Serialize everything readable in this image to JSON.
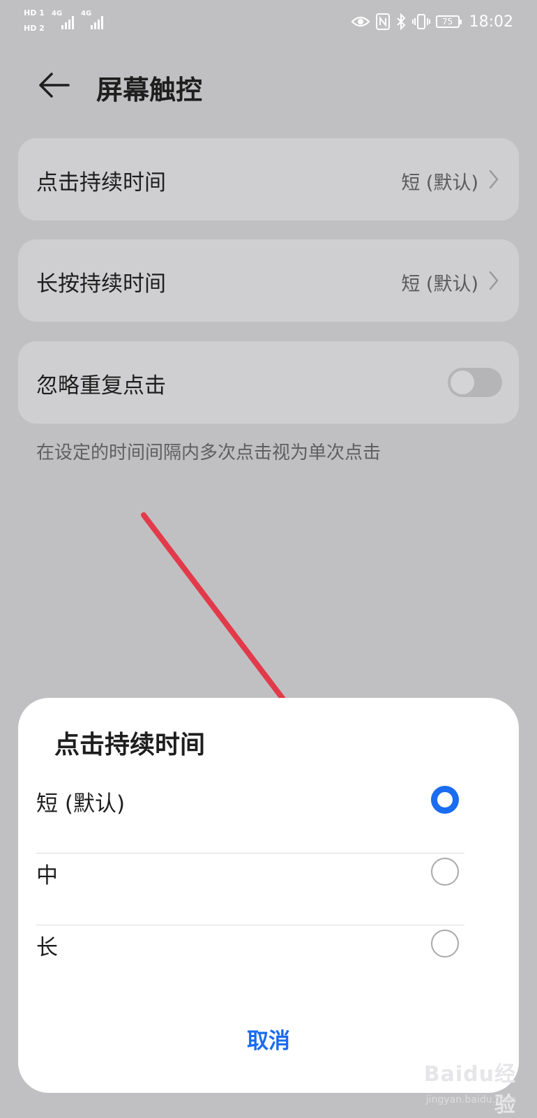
{
  "status_bar": {
    "sim1_label": "HD 1",
    "sim2_label": "HD 2",
    "network1": "4G",
    "network2": "4G",
    "battery_level": "75",
    "time": "18:02",
    "icons": [
      "eye-icon",
      "nfc-icon",
      "bluetooth-icon",
      "vibrate-icon",
      "battery-icon"
    ]
  },
  "header": {
    "title": "屏幕触控"
  },
  "settings": {
    "tap_duration": {
      "label": "点击持续时间",
      "value": "短 (默认)"
    },
    "long_press_duration": {
      "label": "长按持续时间",
      "value": "短 (默认)"
    },
    "ignore_repeat": {
      "label": "忽略重复点击",
      "enabled": false
    },
    "ignore_repeat_hint": "在设定的时间间隔内多次点击视为单次点击"
  },
  "dialog": {
    "title": "点击持续时间",
    "options": [
      {
        "label": "短 (默认)",
        "selected": true
      },
      {
        "label": "中",
        "selected": false
      },
      {
        "label": "长",
        "selected": false
      }
    ],
    "cancel_label": "取消"
  },
  "watermark": {
    "logo": "Baidu经验",
    "url": "jingyan.baidu.com"
  },
  "colors": {
    "accent": "#1a6cf0",
    "annotation_arrow": "#e23a4a",
    "background": "#c0c0c2",
    "card": "#cfcfd1"
  }
}
